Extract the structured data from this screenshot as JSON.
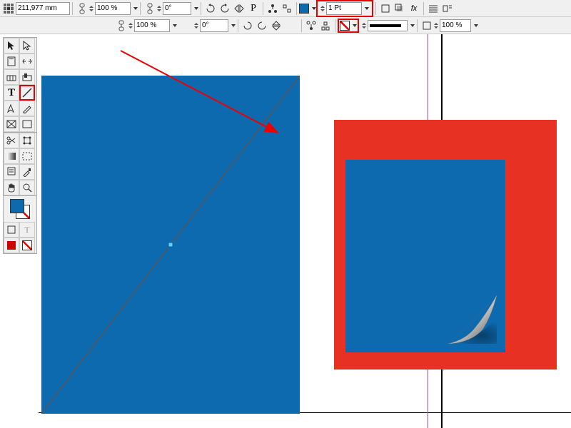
{
  "toolbar": {
    "position_value": "211,977 mm",
    "scale_x": "100 %",
    "scale_y": "100 %",
    "rotation1": "0°",
    "rotation2": "0°",
    "stroke_weight": "1 Pt",
    "opacity": "100 %",
    "fill_color": "#0d6aaf",
    "stroke_color": "#000000"
  },
  "tools": {
    "selection": "Select",
    "direct_select": "Direct Select",
    "page": "Page",
    "gap": "Gap",
    "content1": "Content Collector",
    "content2": "Content Placer",
    "type": "Type",
    "line": "Line",
    "pen": "Pen",
    "pencil": "Pencil",
    "rectangle_frame": "Rectangle Frame",
    "rectangle": "Rectangle",
    "scissors": "Scissors",
    "free_transform": "Free Transform",
    "gradient_swatch": "Gradient Swatch",
    "gradient_feather": "Gradient Feather",
    "note": "Note",
    "eyedropper": "Eyedropper",
    "hand": "Hand",
    "zoom": "Zoom"
  },
  "swatches": {
    "fill": "#0d6aaf",
    "stroke": "none",
    "format_container": "Container",
    "format_text": "Text",
    "apply_color": "Color",
    "apply_none": "None"
  },
  "canvas": {
    "shapes": {
      "left_rect_color": "#0d6aaf",
      "right_bg_color": "#e73223",
      "inner_rect_color": "#0d6aaf"
    }
  }
}
